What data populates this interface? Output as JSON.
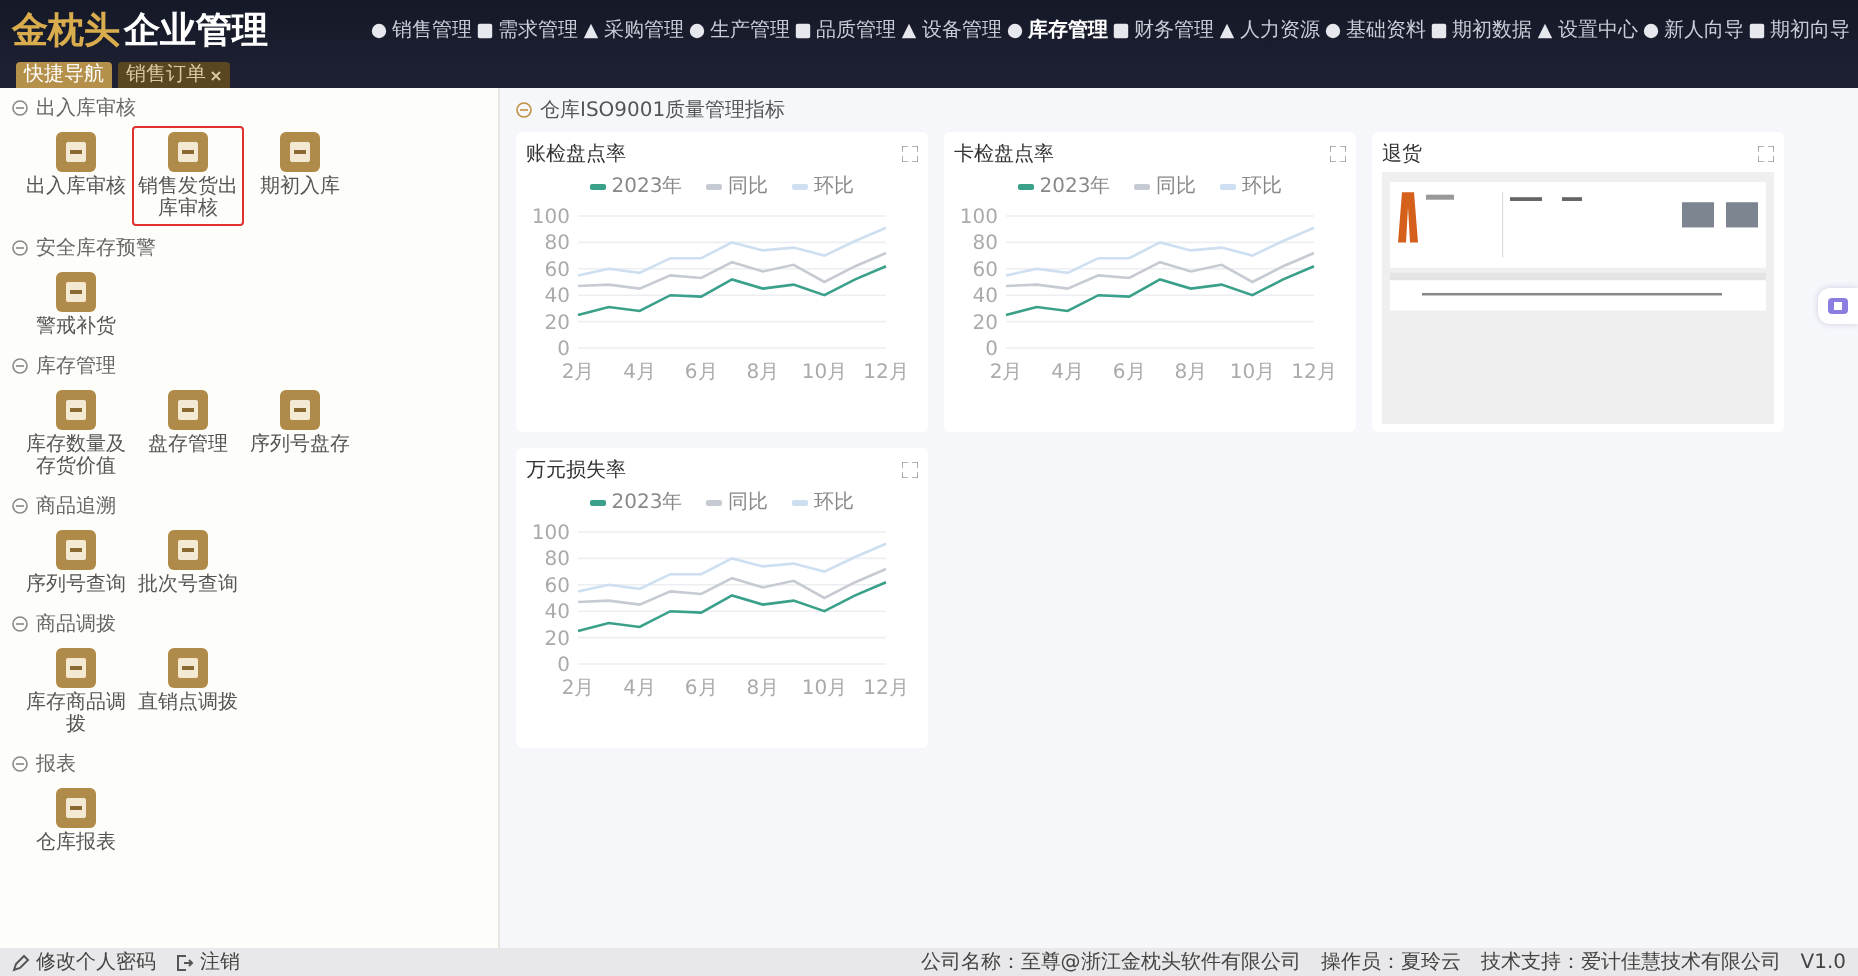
{
  "header": {
    "logo_brand": "金枕头",
    "logo_title": "企业管理"
  },
  "nav": [
    {
      "label": "销售管理",
      "selected": false
    },
    {
      "label": "需求管理",
      "selected": false
    },
    {
      "label": "采购管理",
      "selected": false
    },
    {
      "label": "生产管理",
      "selected": false
    },
    {
      "label": "品质管理",
      "selected": false
    },
    {
      "label": "设备管理",
      "selected": false
    },
    {
      "label": "库存管理",
      "selected": true
    },
    {
      "label": "财务管理",
      "selected": false
    },
    {
      "label": "人力资源",
      "selected": false
    },
    {
      "label": "基础资料",
      "selected": false
    },
    {
      "label": "期初数据",
      "selected": false
    },
    {
      "label": "设置中心",
      "selected": false
    },
    {
      "label": "新人向导",
      "selected": false
    },
    {
      "label": "期初向导",
      "selected": false
    }
  ],
  "tabs": [
    {
      "label": "快捷导航",
      "selected": true,
      "closable": false
    },
    {
      "label": "销售订单",
      "selected": false,
      "closable": true
    }
  ],
  "sidebar": {
    "sections": [
      {
        "title": "出入库审核",
        "items": [
          {
            "label": "出入库审核",
            "selected": false
          },
          {
            "label": "销售发货出库审核",
            "selected": true
          },
          {
            "label": "期初入库",
            "selected": false
          }
        ]
      },
      {
        "title": "安全库存预警",
        "items": [
          {
            "label": "警戒补货",
            "selected": false
          }
        ]
      },
      {
        "title": "库存管理",
        "items": [
          {
            "label": "库存数量及存货价值",
            "selected": false
          },
          {
            "label": "盘存管理",
            "selected": false
          },
          {
            "label": "序列号盘存",
            "selected": false
          }
        ]
      },
      {
        "title": "商品追溯",
        "items": [
          {
            "label": "序列号查询",
            "selected": false
          },
          {
            "label": "批次号查询",
            "selected": false
          }
        ]
      },
      {
        "title": "商品调拨",
        "items": [
          {
            "label": "库存商品调拨",
            "selected": false
          },
          {
            "label": "直销点调拨",
            "selected": false
          }
        ]
      },
      {
        "title": "报表",
        "items": [
          {
            "label": "仓库报表",
            "selected": false
          }
        ]
      }
    ]
  },
  "dashboard": {
    "title": "仓库ISO9001质量管理指标",
    "cards": [
      {
        "kind": "chart",
        "title": "账检盘点率",
        "chart_data": {
          "type": "line",
          "grid": true,
          "xlim": [
            2,
            12
          ],
          "x": [
            2,
            3,
            4,
            5,
            6,
            7,
            8,
            9,
            10,
            11,
            12
          ],
          "xticks": [
            {
              "value": 2,
              "label": "2月"
            },
            {
              "value": 4,
              "label": "4月"
            },
            {
              "value": 6,
              "label": "6月"
            },
            {
              "value": 8,
              "label": "8月"
            },
            {
              "value": 10,
              "label": "10月"
            },
            {
              "value": 12,
              "label": "12月"
            }
          ],
          "ylim": [
            0,
            100
          ],
          "yticks": [
            0,
            20,
            40,
            60,
            80,
            100
          ],
          "series": [
            {
              "name": "2023年",
              "color": "#3aa08a",
              "values": [
                25,
                31,
                28,
                40,
                39,
                52,
                45,
                48,
                40,
                52,
                62
              ]
            },
            {
              "name": "同比",
              "color": "#c6cad2",
              "values": [
                47,
                48,
                45,
                55,
                53,
                65,
                58,
                63,
                50,
                62,
                72
              ]
            },
            {
              "name": "环比",
              "color": "#cddff0",
              "values": [
                55,
                60,
                57,
                68,
                68,
                80,
                74,
                76,
                70,
                81,
                91
              ]
            }
          ]
        }
      },
      {
        "kind": "chart",
        "title": "卡检盘点率",
        "chart_data": {
          "type": "line",
          "grid": true,
          "xlim": [
            2,
            12
          ],
          "x": [
            2,
            3,
            4,
            5,
            6,
            7,
            8,
            9,
            10,
            11,
            12
          ],
          "xticks": [
            {
              "value": 2,
              "label": "2月"
            },
            {
              "value": 4,
              "label": "4月"
            },
            {
              "value": 6,
              "label": "6月"
            },
            {
              "value": 8,
              "label": "8月"
            },
            {
              "value": 10,
              "label": "10月"
            },
            {
              "value": 12,
              "label": "12月"
            }
          ],
          "ylim": [
            0,
            100
          ],
          "yticks": [
            0,
            20,
            40,
            60,
            80,
            100
          ],
          "series": [
            {
              "name": "2023年",
              "color": "#3aa08a",
              "values": [
                25,
                31,
                28,
                40,
                39,
                52,
                45,
                48,
                40,
                52,
                62
              ]
            },
            {
              "name": "同比",
              "color": "#c6cad2",
              "values": [
                47,
                48,
                45,
                55,
                53,
                65,
                58,
                63,
                50,
                62,
                72
              ]
            },
            {
              "name": "环比",
              "color": "#cddff0",
              "values": [
                55,
                60,
                57,
                68,
                68,
                80,
                74,
                76,
                70,
                81,
                91
              ]
            }
          ]
        }
      },
      {
        "kind": "picture",
        "title": "退货"
      },
      {
        "kind": "chart",
        "title": "万元损失率",
        "chart_data": {
          "type": "line",
          "grid": true,
          "xlim": [
            2,
            12
          ],
          "x": [
            2,
            3,
            4,
            5,
            6,
            7,
            8,
            9,
            10,
            11,
            12
          ],
          "xticks": [
            {
              "value": 2,
              "label": "2月"
            },
            {
              "value": 4,
              "label": "4月"
            },
            {
              "value": 6,
              "label": "6月"
            },
            {
              "value": 8,
              "label": "8月"
            },
            {
              "value": 10,
              "label": "10月"
            },
            {
              "value": 12,
              "label": "12月"
            }
          ],
          "ylim": [
            0,
            100
          ],
          "yticks": [
            0,
            20,
            40,
            60,
            80,
            100
          ],
          "series": [
            {
              "name": "2023年",
              "color": "#3aa08a",
              "values": [
                25,
                31,
                28,
                40,
                39,
                52,
                45,
                48,
                40,
                52,
                62
              ]
            },
            {
              "name": "同比",
              "color": "#c6cad2",
              "values": [
                47,
                48,
                45,
                55,
                53,
                65,
                58,
                63,
                50,
                62,
                72
              ]
            },
            {
              "name": "环比",
              "color": "#cddff0",
              "values": [
                55,
                60,
                57,
                68,
                68,
                80,
                74,
                76,
                70,
                81,
                91
              ]
            }
          ]
        }
      }
    ]
  },
  "footer": {
    "links": [
      "修改个人密码",
      "注销"
    ],
    "company": "公司名称：至尊@浙江金枕头软件有限公司",
    "operator": "操作员：夏玲云",
    "support": "技术支持：爱计佳慧技术有限公司",
    "version": "V1.0"
  }
}
